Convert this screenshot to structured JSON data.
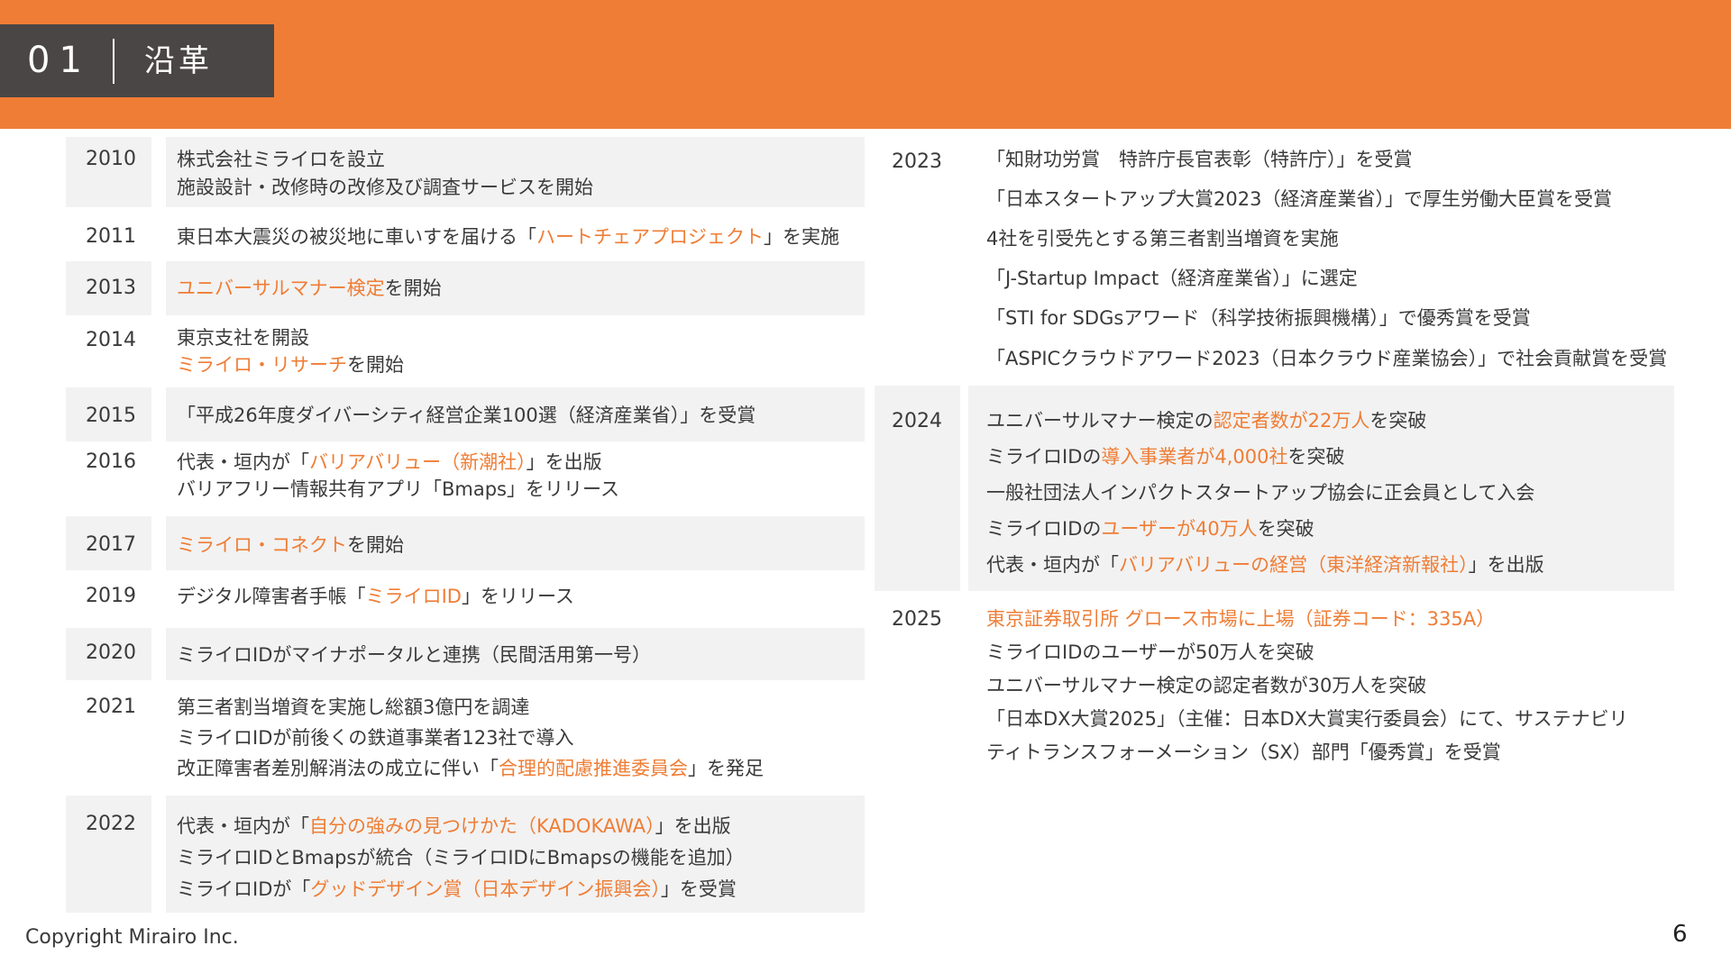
{
  "header": {
    "section_number": "01",
    "section_title": "沿革"
  },
  "left": [
    {
      "year": "2010",
      "lines": [
        [
          {
            "t": "株式会社ミライロを設立"
          }
        ],
        [
          {
            "t": "施設設計・改修時の改修及び調査サービスを開始"
          }
        ]
      ]
    },
    {
      "year": "2011",
      "lines": [
        [
          {
            "t": "東日本大震災の被災地に車いすを届ける「"
          },
          {
            "t": "ハートチェアプロジェクト",
            "h": true
          },
          {
            "t": "」を実施"
          }
        ]
      ]
    },
    {
      "year": "2013",
      "lines": [
        [
          {
            "t": "ユニバーサルマナー検定",
            "h": true
          },
          {
            "t": "を開始"
          }
        ]
      ]
    },
    {
      "year": "2014",
      "lines": [
        [
          {
            "t": "東京支社を開設"
          }
        ],
        [
          {
            "t": "ミライロ・リサーチ",
            "h": true
          },
          {
            "t": "を開始"
          }
        ]
      ]
    },
    {
      "year": "2015",
      "lines": [
        [
          {
            "t": "「平成26年度ダイバーシティ経営企業100選（経済産業省）」を受賞"
          }
        ]
      ]
    },
    {
      "year": "2016",
      "lines": [
        [
          {
            "t": "代表・垣内が「"
          },
          {
            "t": "バリアバリュー（新潮社）",
            "h": true
          },
          {
            "t": "」を出版"
          }
        ],
        [
          {
            "t": "バリアフリー情報共有アプリ「Bmaps」をリリース"
          }
        ]
      ]
    },
    {
      "year": "2017",
      "lines": [
        [
          {
            "t": "ミライロ・コネクト",
            "h": true
          },
          {
            "t": "を開始"
          }
        ]
      ]
    },
    {
      "year": "2019",
      "lines": [
        [
          {
            "t": "デジタル障害者手帳「"
          },
          {
            "t": "ミライロID",
            "h": true
          },
          {
            "t": "」をリリース"
          }
        ]
      ]
    },
    {
      "year": "2020",
      "lines": [
        [
          {
            "t": "ミライロIDがマイナポータルと連携（民間活用第一号）"
          }
        ]
      ]
    },
    {
      "year": "2021",
      "lines": [
        [
          {
            "t": "第三者割当増資を実施し総額3億円を調達"
          }
        ],
        [
          {
            "t": "ミライロIDが前後くの鉄道事業者123社で導入"
          }
        ],
        [
          {
            "t": "改正障害者差別解消法の成立に伴い「"
          },
          {
            "t": "合理的配慮推進委員会",
            "h": true
          },
          {
            "t": "」を発足"
          }
        ]
      ]
    },
    {
      "year": "2022",
      "lines": [
        [
          {
            "t": "代表・垣内が「"
          },
          {
            "t": "自分の強みの見つけかた（KADOKAWA）",
            "h": true
          },
          {
            "t": "」を出版"
          }
        ],
        [
          {
            "t": "ミライロIDとBmapsが統合（ミライロIDにBmapsの機能を追加）"
          }
        ],
        [
          {
            "t": "ミライロIDが「"
          },
          {
            "t": "グッドデザイン賞（日本デザイン振興会）",
            "h": true
          },
          {
            "t": "」を受賞"
          }
        ]
      ]
    }
  ],
  "right": [
    {
      "year": "2023",
      "lines": [
        [
          {
            "t": "「知財功労賞　特許庁長官表彰（特許庁）」を受賞"
          }
        ],
        [
          {
            "t": "「日本スタートアップ大賞2023（経済産業省）」で厚生労働大臣賞を受賞"
          }
        ],
        [
          {
            "t": "4社を引受先とする第三者割当増資を実施"
          }
        ],
        [
          {
            "t": "「J-Startup Impact（経済産業省）」に選定"
          }
        ],
        [
          {
            "t": "「STI for SDGsアワード（科学技術振興機構）」で優秀賞を受賞"
          }
        ],
        [
          {
            "t": "「ASPICクラウドアワード2023（日本クラウド産業協会）」で社会貢献賞を受賞"
          }
        ]
      ]
    },
    {
      "year": "2024",
      "lines": [
        [
          {
            "t": "ユニバーサルマナー検定の"
          },
          {
            "t": "認定者数が22万人",
            "h": true
          },
          {
            "t": "を突破"
          }
        ],
        [
          {
            "t": "ミライロIDの"
          },
          {
            "t": "導入事業者が4,000社",
            "h": true
          },
          {
            "t": "を突破"
          }
        ],
        [
          {
            "t": "一般社団法人インパクトスタートアップ協会に正会員として入会"
          }
        ],
        [
          {
            "t": "ミライロIDの"
          },
          {
            "t": "ユーザーが40万人",
            "h": true
          },
          {
            "t": "を突破"
          }
        ],
        [
          {
            "t": "代表・垣内が「"
          },
          {
            "t": "バリアバリューの経営（東洋経済新報社）",
            "h": true
          },
          {
            "t": "」を出版"
          }
        ]
      ]
    },
    {
      "year": "2025",
      "lines": [
        [
          {
            "t": "東京証券取引所 グロース市場に上場（証券コード：335A）",
            "h": true
          }
        ],
        [
          {
            "t": "ミライロIDのユーザーが50万人を突破"
          }
        ],
        [
          {
            "t": "ユニバーサルマナー検定の認定者数が30万人を突破"
          }
        ],
        [
          {
            "t": "「日本DX大賞2025」（主催：日本DX大賞実行委員会）にて、サステナビリ"
          }
        ],
        [
          {
            "t": "ティトランスフォーメーション（SX）部門「優秀賞」を受賞"
          }
        ]
      ]
    }
  ],
  "footer": {
    "copyright": "Copyright Mirairo Inc.",
    "page_number": "6"
  }
}
